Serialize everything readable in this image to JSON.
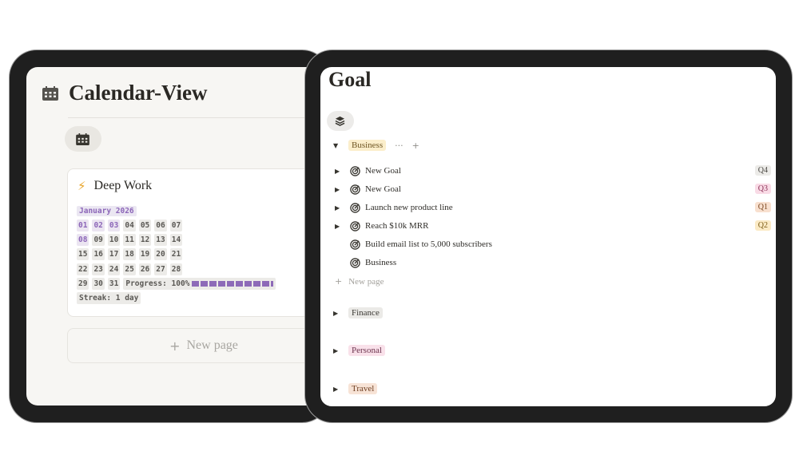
{
  "calendar_view": {
    "title": "Calendar-View",
    "card": {
      "title": "Deep Work",
      "month_label": "January 2026",
      "weeks": [
        [
          "01",
          "02",
          "03",
          "04",
          "05",
          "06",
          "07"
        ],
        [
          "08",
          "09",
          "10",
          "11",
          "12",
          "13",
          "14"
        ],
        [
          "15",
          "16",
          "17",
          "18",
          "19",
          "20",
          "21"
        ],
        [
          "22",
          "23",
          "24",
          "25",
          "26",
          "27",
          "28"
        ],
        [
          "29",
          "30",
          "31"
        ]
      ],
      "progress_label": "Progress: 100%",
      "progress_fraction": 1.0,
      "streak_label": "Streak: 1 day"
    },
    "new_page_label": "New page"
  },
  "goal_view": {
    "title": "Goal",
    "groups": [
      {
        "tag": "Business",
        "tag_class": "business",
        "expanded": true,
        "items": [
          {
            "label": "New Goal",
            "quarter": "Q4",
            "quarter_class": "q4",
            "expandable": true
          },
          {
            "label": "New Goal",
            "quarter": "Q3",
            "quarter_class": "q3",
            "expandable": true
          },
          {
            "label": "Launch new product line",
            "quarter": "Q1",
            "quarter_class": "q1",
            "expandable": true
          },
          {
            "label": "Reach $10k MRR",
            "quarter": "Q2",
            "quarter_class": "q2",
            "expandable": true
          },
          {
            "label": "Build email list to 5,000 subscribers",
            "quarter": "",
            "expandable": false
          },
          {
            "label": "Business",
            "quarter": "",
            "expandable": false
          }
        ],
        "new_page_label": "New page"
      },
      {
        "tag": "Finance",
        "tag_class": "finance",
        "expanded": false
      },
      {
        "tag": "Personal",
        "tag_class": "personal",
        "expanded": false
      },
      {
        "tag": "Travel",
        "tag_class": "travel",
        "expanded": false
      }
    ],
    "group_more_glyph": "···",
    "group_add_glyph": "+"
  },
  "icons": [
    "calendar-icon",
    "lightning-icon",
    "layers-icon",
    "target-icon",
    "triangle-right-icon",
    "triangle-down-icon",
    "plus-icon"
  ],
  "colors": {
    "accent_purple": "#8c66b8",
    "bolt": "#e8a42a"
  }
}
